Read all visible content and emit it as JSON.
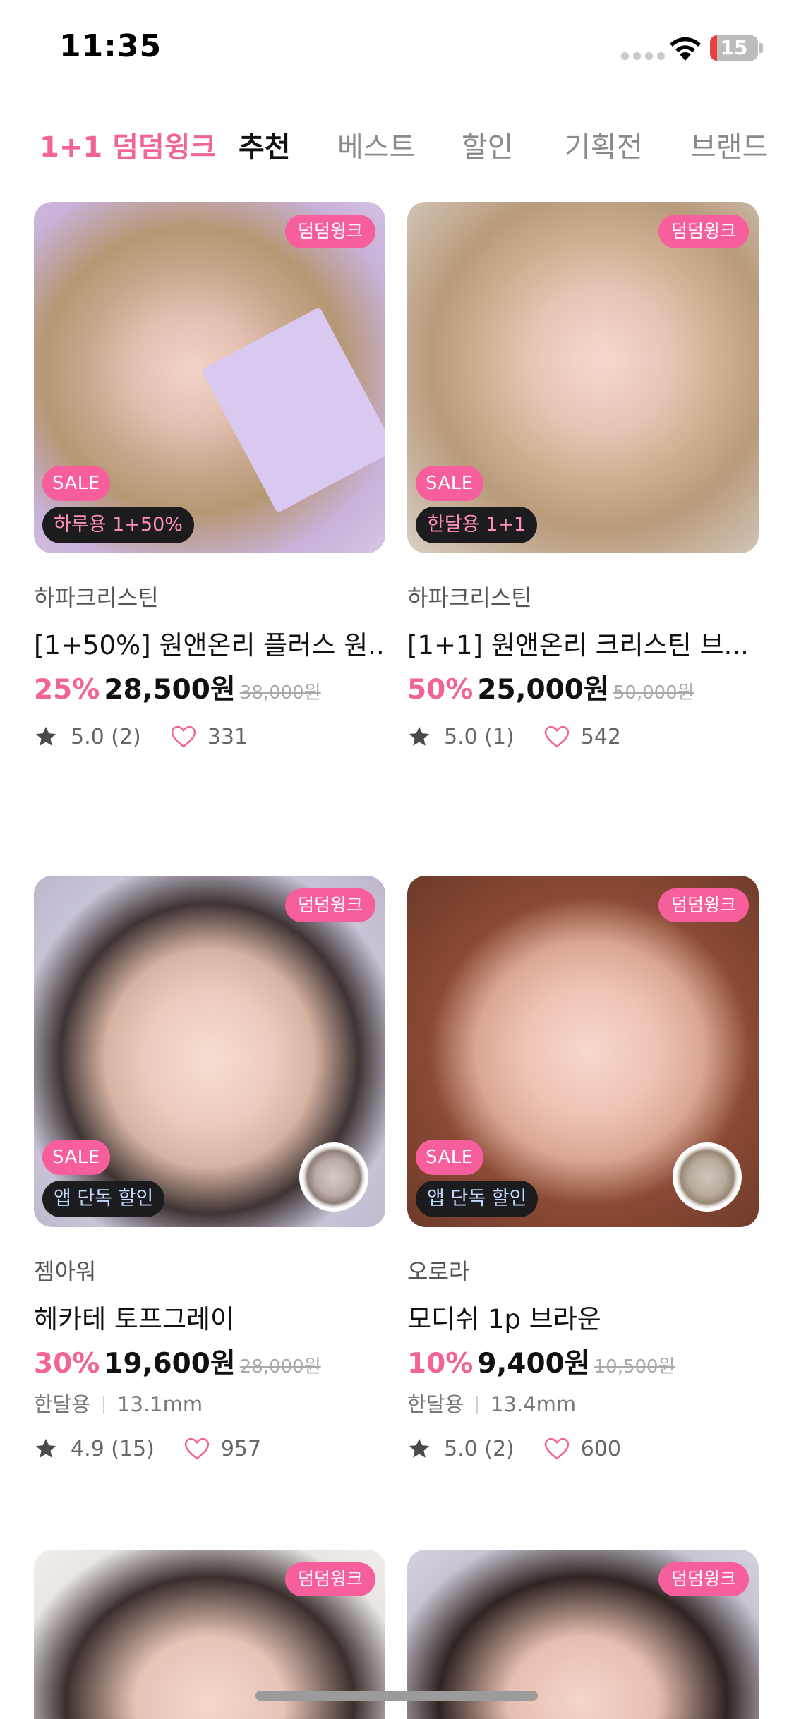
{
  "status_bar": {
    "time": "11:35",
    "battery": "15",
    "battery_level": 0.15
  },
  "tabs": [
    {
      "label": "1+1 덤덤윙크",
      "state": "promo"
    },
    {
      "label": "추천",
      "state": "active"
    },
    {
      "label": "베스트",
      "state": "inactive"
    },
    {
      "label": "할인",
      "state": "inactive"
    },
    {
      "label": "기획전",
      "state": "inactive"
    },
    {
      "label": "브랜드",
      "state": "inactive"
    }
  ],
  "products": [
    {
      "brand_badge": "덤덤윙크",
      "sale_badge": "SALE",
      "deal_badge": "하루용 1+50%",
      "shop": "하파크리스틴",
      "title": "[1+50%] 원앤온리 플러스 원...",
      "discount": "25%",
      "price": "28,500원",
      "original_price": "38,000원",
      "rating": "5.0 (2)",
      "likes": "331"
    },
    {
      "brand_badge": "덤덤윙크",
      "sale_badge": "SALE",
      "deal_badge": "한달용 1+1",
      "shop": "하파크리스틴",
      "title": "[1+1] 원앤온리 크리스틴 브...",
      "discount": "50%",
      "price": "25,000원",
      "original_price": "50,000원",
      "rating": "5.0 (1)",
      "likes": "542"
    },
    {
      "brand_badge": "덤덤윙크",
      "sale_badge": "SALE",
      "deal_badge": "앱 단독 할인",
      "shop": "젬아워",
      "title": "헤카테 토프그레이",
      "discount": "30%",
      "price": "19,600원",
      "original_price": "28,000원",
      "spec_period": "한달용",
      "spec_size": "13.1mm",
      "rating": "4.9 (15)",
      "likes": "957"
    },
    {
      "brand_badge": "덤덤윙크",
      "sale_badge": "SALE",
      "deal_badge": "앱 단독 할인",
      "shop": "오로라",
      "title": "모디쉬 1p 브라운",
      "discount": "10%",
      "price": "9,400원",
      "original_price": "10,500원",
      "spec_period": "한달용",
      "spec_size": "13.4mm",
      "rating": "5.0 (2)",
      "likes": "600"
    },
    {
      "brand_badge": "덤덤윙크"
    },
    {
      "brand_badge": "덤덤윙크"
    }
  ],
  "icons": {
    "star": "star-icon",
    "heart": "heart-outline-icon",
    "wifi": "wifi-icon",
    "battery": "battery-icon"
  },
  "colors": {
    "accent": "#f26398",
    "badge_pink": "#f65f9b",
    "badge_dark": "#1c1c1e"
  }
}
